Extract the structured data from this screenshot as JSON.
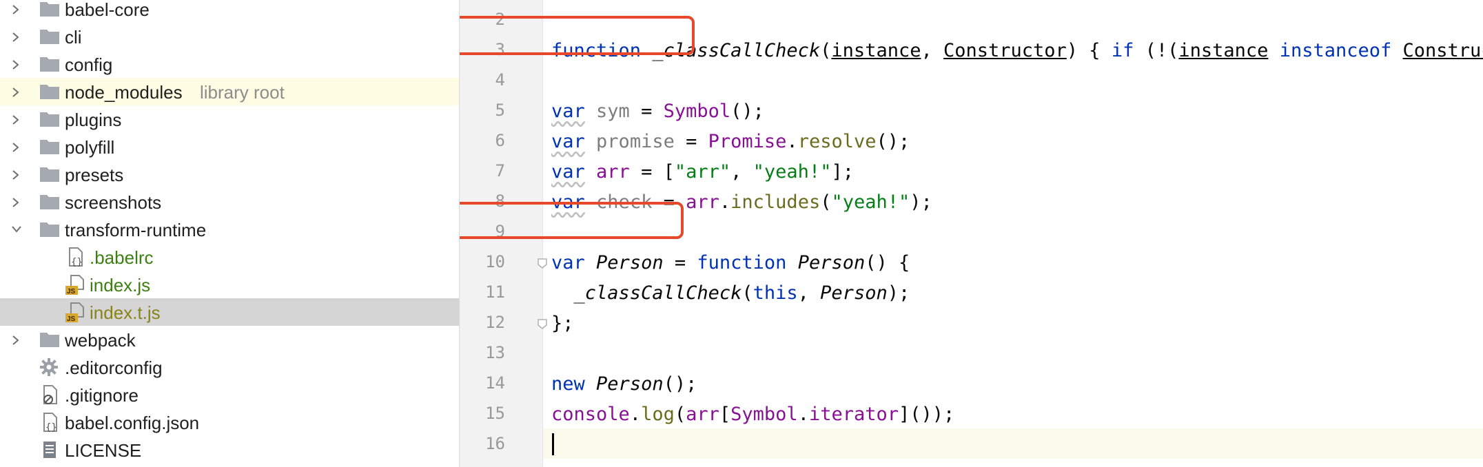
{
  "tree": {
    "items": [
      {
        "label": "babel-core",
        "type": "folder",
        "expand": "collapsed",
        "indent": 0
      },
      {
        "label": "cli",
        "type": "folder",
        "expand": "collapsed",
        "indent": 0
      },
      {
        "label": "config",
        "type": "folder",
        "expand": "collapsed",
        "indent": 0
      },
      {
        "label": "node_modules",
        "hint": "library root",
        "type": "folder",
        "expand": "collapsed",
        "indent": 0,
        "style": "lib"
      },
      {
        "label": "plugins",
        "type": "folder",
        "expand": "collapsed",
        "indent": 0
      },
      {
        "label": "polyfill",
        "type": "folder",
        "expand": "collapsed",
        "indent": 0
      },
      {
        "label": "presets",
        "type": "folder",
        "expand": "collapsed",
        "indent": 0
      },
      {
        "label": "screenshots",
        "type": "folder",
        "expand": "collapsed",
        "indent": 0
      },
      {
        "label": "transform-runtime",
        "type": "folder",
        "expand": "expanded",
        "indent": 0
      },
      {
        "label": ".babelrc",
        "type": "json",
        "indent": 1,
        "color": "green"
      },
      {
        "label": "index.js",
        "type": "js",
        "indent": 1,
        "color": "green"
      },
      {
        "label": "index.t.js",
        "type": "js",
        "indent": 1,
        "color": "olive",
        "style": "sel"
      },
      {
        "label": "webpack",
        "type": "folder",
        "expand": "collapsed",
        "indent": 0
      },
      {
        "label": ".editorconfig",
        "type": "gear",
        "indent": 0
      },
      {
        "label": ".gitignore",
        "type": "ignore",
        "indent": 0
      },
      {
        "label": "babel.config.json",
        "type": "json",
        "indent": 0
      },
      {
        "label": "LICENSE",
        "type": "text",
        "indent": 0
      }
    ]
  },
  "editor": {
    "line_numbers": [
      "2",
      "3",
      "4",
      "5",
      "6",
      "7",
      "8",
      "9",
      "10",
      "11",
      "12",
      "13",
      "14",
      "15",
      "16"
    ],
    "current_line": "16",
    "lines": [
      {
        "n": "2",
        "tokens": []
      },
      {
        "n": "3",
        "tokens": [
          {
            "t": "function",
            "c": "kw"
          },
          {
            "t": " "
          },
          {
            "t": "_classCallCheck",
            "c": "fn"
          },
          {
            "t": "("
          },
          {
            "t": "instance",
            "c": "ul"
          },
          {
            "t": ", "
          },
          {
            "t": "Constructor",
            "c": "ul"
          },
          {
            "t": ") { "
          },
          {
            "t": "if",
            "c": "kw"
          },
          {
            "t": " (!("
          },
          {
            "t": "instance",
            "c": "ul"
          },
          {
            "t": " "
          },
          {
            "t": "instanceof",
            "c": "kw"
          },
          {
            "t": " "
          },
          {
            "t": "Constructor",
            "c": "ul"
          }
        ]
      },
      {
        "n": "4",
        "tokens": []
      },
      {
        "n": "5",
        "tokens": [
          {
            "t": "var",
            "c": "kw warn"
          },
          {
            "t": " "
          },
          {
            "t": "sym",
            "c": "vdim"
          },
          {
            "t": " = "
          },
          {
            "t": "Symbol",
            "c": "vclr"
          },
          {
            "t": "();"
          }
        ]
      },
      {
        "n": "6",
        "tokens": [
          {
            "t": "var",
            "c": "kw warn"
          },
          {
            "t": " "
          },
          {
            "t": "promise",
            "c": "vdim"
          },
          {
            "t": " = "
          },
          {
            "t": "Promise",
            "c": "vclr"
          },
          {
            "t": "."
          },
          {
            "t": "resolve",
            "c": "meth"
          },
          {
            "t": "();"
          }
        ]
      },
      {
        "n": "7",
        "tokens": [
          {
            "t": "var",
            "c": "kw warn"
          },
          {
            "t": " "
          },
          {
            "t": "arr",
            "c": "vclr"
          },
          {
            "t": " = ["
          },
          {
            "t": "\"arr\"",
            "c": "str"
          },
          {
            "t": ", "
          },
          {
            "t": "\"yeah!\"",
            "c": "str"
          },
          {
            "t": "];"
          }
        ]
      },
      {
        "n": "8",
        "tokens": [
          {
            "t": "var",
            "c": "kw warn"
          },
          {
            "t": " "
          },
          {
            "t": "check",
            "c": "vdim"
          },
          {
            "t": " = "
          },
          {
            "t": "arr",
            "c": "vclr"
          },
          {
            "t": "."
          },
          {
            "t": "includes",
            "c": "meth"
          },
          {
            "t": "("
          },
          {
            "t": "\"yeah!\"",
            "c": "str"
          },
          {
            "t": ");"
          }
        ]
      },
      {
        "n": "9",
        "tokens": []
      },
      {
        "n": "10",
        "tokens": [
          {
            "t": "var",
            "c": "kw"
          },
          {
            "t": " "
          },
          {
            "t": "Person",
            "c": "fn"
          },
          {
            "t": " = "
          },
          {
            "t": "function",
            "c": "kw"
          },
          {
            "t": " "
          },
          {
            "t": "Person",
            "c": "fn"
          },
          {
            "t": "() {"
          }
        ]
      },
      {
        "n": "11",
        "tokens": [
          {
            "t": "  "
          },
          {
            "t": "_classCallCheck",
            "c": "fn"
          },
          {
            "t": "("
          },
          {
            "t": "this",
            "c": "kw"
          },
          {
            "t": ", "
          },
          {
            "t": "Person",
            "c": "fn"
          },
          {
            "t": ");"
          }
        ]
      },
      {
        "n": "12",
        "tokens": [
          {
            "t": "};"
          }
        ]
      },
      {
        "n": "13",
        "tokens": []
      },
      {
        "n": "14",
        "tokens": [
          {
            "t": "new",
            "c": "kw"
          },
          {
            "t": " "
          },
          {
            "t": "Person",
            "c": "fn"
          },
          {
            "t": "();"
          }
        ]
      },
      {
        "n": "15",
        "tokens": [
          {
            "t": "console",
            "c": "vclr"
          },
          {
            "t": "."
          },
          {
            "t": "log",
            "c": "meth"
          },
          {
            "t": "("
          },
          {
            "t": "arr",
            "c": "vclr"
          },
          {
            "t": "["
          },
          {
            "t": "Symbol",
            "c": "vclr"
          },
          {
            "t": "."
          },
          {
            "t": "iterator",
            "c": "vclr"
          },
          {
            "t": "]());"
          }
        ]
      },
      {
        "n": "16",
        "tokens": []
      }
    ]
  },
  "colors": {
    "highlight_box": "#e8472a",
    "keyword": "#0033b3",
    "string": "#067d17",
    "library_row": "#fefce3",
    "selected_row": "#d5d5d5"
  }
}
